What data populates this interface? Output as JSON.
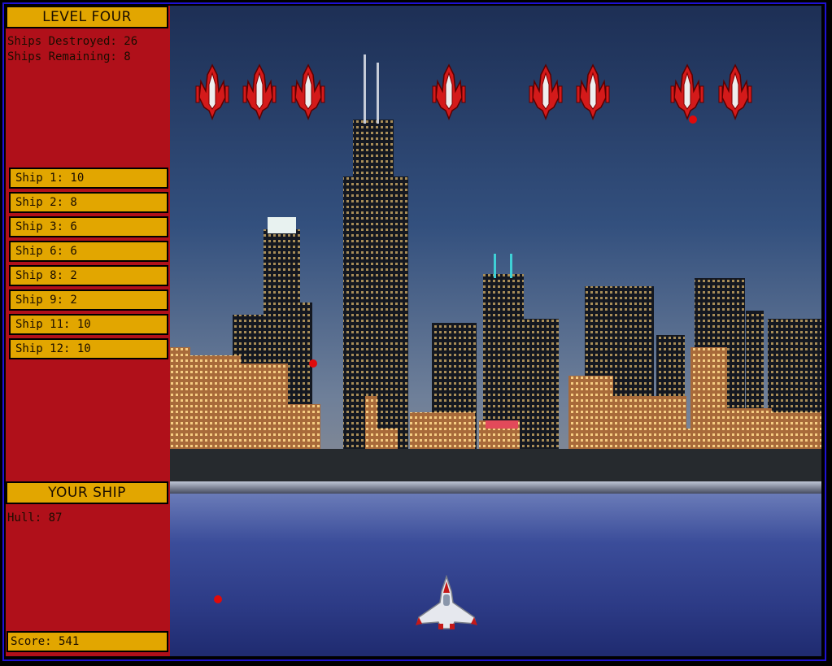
{
  "level": {
    "title": "LEVEL FOUR"
  },
  "stats": {
    "destroyed": "Ships Destroyed: 26",
    "remaining": "Ships Remaining: 8"
  },
  "enemy_ships": [
    "Ship 1: 10",
    "Ship 2: 8",
    "Ship 3: 6",
    "Ship 6: 6",
    "Ship 8: 2",
    "Ship 9: 2",
    "Ship 11: 10",
    "Ship 12: 10"
  ],
  "your_ship": {
    "title": "YOUR SHIP",
    "hull": "Hull: 87"
  },
  "score": "Score: 541",
  "colors": {
    "panel": "#b0101a",
    "gold": "#e2a600",
    "border": "#1f12d4",
    "bullet": "#e00a0a"
  },
  "icons": {
    "enemy": "enemy-ship-icon",
    "player": "player-ship-icon"
  }
}
